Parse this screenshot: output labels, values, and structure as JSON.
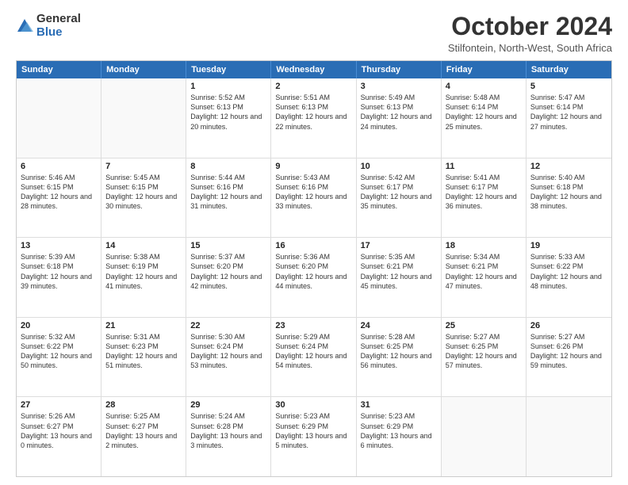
{
  "logo": {
    "general": "General",
    "blue": "Blue"
  },
  "title": "October 2024",
  "subtitle": "Stilfontein, North-West, South Africa",
  "header": {
    "days": [
      "Sunday",
      "Monday",
      "Tuesday",
      "Wednesday",
      "Thursday",
      "Friday",
      "Saturday"
    ]
  },
  "rows": [
    [
      {
        "day": "",
        "info": ""
      },
      {
        "day": "",
        "info": ""
      },
      {
        "day": "1",
        "info": "Sunrise: 5:52 AM\nSunset: 6:13 PM\nDaylight: 12 hours and 20 minutes."
      },
      {
        "day": "2",
        "info": "Sunrise: 5:51 AM\nSunset: 6:13 PM\nDaylight: 12 hours and 22 minutes."
      },
      {
        "day": "3",
        "info": "Sunrise: 5:49 AM\nSunset: 6:13 PM\nDaylight: 12 hours and 24 minutes."
      },
      {
        "day": "4",
        "info": "Sunrise: 5:48 AM\nSunset: 6:14 PM\nDaylight: 12 hours and 25 minutes."
      },
      {
        "day": "5",
        "info": "Sunrise: 5:47 AM\nSunset: 6:14 PM\nDaylight: 12 hours and 27 minutes."
      }
    ],
    [
      {
        "day": "6",
        "info": "Sunrise: 5:46 AM\nSunset: 6:15 PM\nDaylight: 12 hours and 28 minutes."
      },
      {
        "day": "7",
        "info": "Sunrise: 5:45 AM\nSunset: 6:15 PM\nDaylight: 12 hours and 30 minutes."
      },
      {
        "day": "8",
        "info": "Sunrise: 5:44 AM\nSunset: 6:16 PM\nDaylight: 12 hours and 31 minutes."
      },
      {
        "day": "9",
        "info": "Sunrise: 5:43 AM\nSunset: 6:16 PM\nDaylight: 12 hours and 33 minutes."
      },
      {
        "day": "10",
        "info": "Sunrise: 5:42 AM\nSunset: 6:17 PM\nDaylight: 12 hours and 35 minutes."
      },
      {
        "day": "11",
        "info": "Sunrise: 5:41 AM\nSunset: 6:17 PM\nDaylight: 12 hours and 36 minutes."
      },
      {
        "day": "12",
        "info": "Sunrise: 5:40 AM\nSunset: 6:18 PM\nDaylight: 12 hours and 38 minutes."
      }
    ],
    [
      {
        "day": "13",
        "info": "Sunrise: 5:39 AM\nSunset: 6:18 PM\nDaylight: 12 hours and 39 minutes."
      },
      {
        "day": "14",
        "info": "Sunrise: 5:38 AM\nSunset: 6:19 PM\nDaylight: 12 hours and 41 minutes."
      },
      {
        "day": "15",
        "info": "Sunrise: 5:37 AM\nSunset: 6:20 PM\nDaylight: 12 hours and 42 minutes."
      },
      {
        "day": "16",
        "info": "Sunrise: 5:36 AM\nSunset: 6:20 PM\nDaylight: 12 hours and 44 minutes."
      },
      {
        "day": "17",
        "info": "Sunrise: 5:35 AM\nSunset: 6:21 PM\nDaylight: 12 hours and 45 minutes."
      },
      {
        "day": "18",
        "info": "Sunrise: 5:34 AM\nSunset: 6:21 PM\nDaylight: 12 hours and 47 minutes."
      },
      {
        "day": "19",
        "info": "Sunrise: 5:33 AM\nSunset: 6:22 PM\nDaylight: 12 hours and 48 minutes."
      }
    ],
    [
      {
        "day": "20",
        "info": "Sunrise: 5:32 AM\nSunset: 6:22 PM\nDaylight: 12 hours and 50 minutes."
      },
      {
        "day": "21",
        "info": "Sunrise: 5:31 AM\nSunset: 6:23 PM\nDaylight: 12 hours and 51 minutes."
      },
      {
        "day": "22",
        "info": "Sunrise: 5:30 AM\nSunset: 6:24 PM\nDaylight: 12 hours and 53 minutes."
      },
      {
        "day": "23",
        "info": "Sunrise: 5:29 AM\nSunset: 6:24 PM\nDaylight: 12 hours and 54 minutes."
      },
      {
        "day": "24",
        "info": "Sunrise: 5:28 AM\nSunset: 6:25 PM\nDaylight: 12 hours and 56 minutes."
      },
      {
        "day": "25",
        "info": "Sunrise: 5:27 AM\nSunset: 6:25 PM\nDaylight: 12 hours and 57 minutes."
      },
      {
        "day": "26",
        "info": "Sunrise: 5:27 AM\nSunset: 6:26 PM\nDaylight: 12 hours and 59 minutes."
      }
    ],
    [
      {
        "day": "27",
        "info": "Sunrise: 5:26 AM\nSunset: 6:27 PM\nDaylight: 13 hours and 0 minutes."
      },
      {
        "day": "28",
        "info": "Sunrise: 5:25 AM\nSunset: 6:27 PM\nDaylight: 13 hours and 2 minutes."
      },
      {
        "day": "29",
        "info": "Sunrise: 5:24 AM\nSunset: 6:28 PM\nDaylight: 13 hours and 3 minutes."
      },
      {
        "day": "30",
        "info": "Sunrise: 5:23 AM\nSunset: 6:29 PM\nDaylight: 13 hours and 5 minutes."
      },
      {
        "day": "31",
        "info": "Sunrise: 5:23 AM\nSunset: 6:29 PM\nDaylight: 13 hours and 6 minutes."
      },
      {
        "day": "",
        "info": ""
      },
      {
        "day": "",
        "info": ""
      }
    ]
  ]
}
